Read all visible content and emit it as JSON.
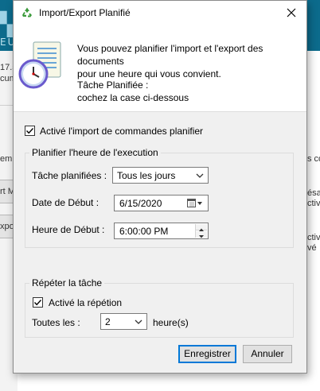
{
  "background": {
    "logo_text": "▚ZE",
    "logo_sub": "EU",
    "left_texts": [
      "17.5",
      "cum"
    ],
    "left_labels": [
      "em",
      "rt M",
      "xpo"
    ],
    "right_texts": [
      "s co",
      "ésac",
      "ctiv",
      "ctiv",
      "vé"
    ]
  },
  "dialog": {
    "title": "Import/Export Planifié",
    "close_icon": "close-icon",
    "description_line1": "Vous pouvez planifier l'import et l'export des documents",
    "description_line2": "pour une heure qui vous convient.",
    "task_label": "Tâche Planifiée :",
    "task_hint": "cochez la case ci-dessous",
    "enable_import": {
      "label": "Activé l'import de commandes planifier",
      "checked": true
    },
    "schedule_group": {
      "title": "Planifier l'heure de l'execution",
      "tasks_label": "Tâche planifiées :",
      "tasks_value": "Tous les jours",
      "start_date_label": "Date de Début :",
      "start_date_value": "6/15/2020",
      "start_time_label": "Heure de Début :",
      "start_time_value": "6:00:00 PM"
    },
    "repeat_group": {
      "title": "Répéter la tâche",
      "enable_repeat": {
        "label": "Activé la répétion",
        "checked": true
      },
      "every_label": "Toutes les :",
      "every_value": "2",
      "unit_label": "heure(s)"
    },
    "buttons": {
      "save": "Enregistrer",
      "cancel": "Annuler"
    }
  },
  "colors": {
    "accent": "#0078d7",
    "banner": "#0c6b8c",
    "dialog_bg": "#f0f0f0"
  }
}
